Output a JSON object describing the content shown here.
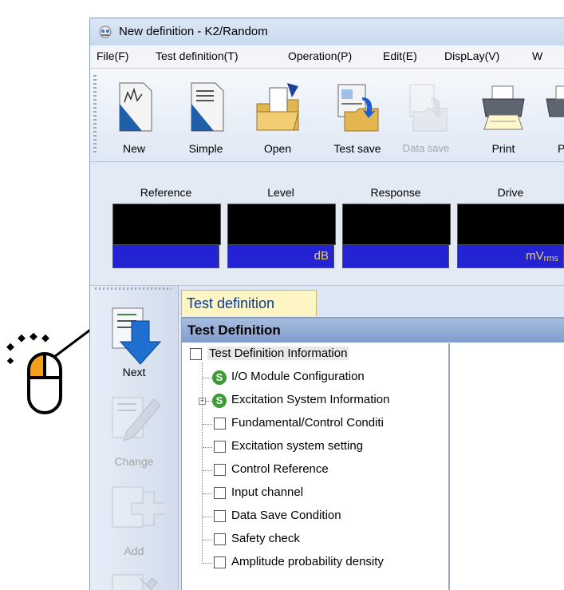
{
  "window": {
    "title": "New definition - K2/Random"
  },
  "menu": {
    "items": [
      "File(F)",
      "Test definition(T)",
      "Operation(P)",
      "Edit(E)",
      "DispLay(V)",
      "W"
    ]
  },
  "toolbar": {
    "buttons": [
      {
        "label": "New",
        "icon": "new-document-icon",
        "enabled": true
      },
      {
        "label": "Simple",
        "icon": "simple-document-icon",
        "enabled": true
      },
      {
        "label": "Open",
        "icon": "open-folder-icon",
        "enabled": true
      },
      {
        "label": "Test save",
        "icon": "test-save-icon",
        "enabled": true
      },
      {
        "label": "Data save",
        "icon": "data-save-icon",
        "enabled": false
      },
      {
        "label": "Print",
        "icon": "printer-icon",
        "enabled": true
      },
      {
        "label": "Pr",
        "icon": "print-preview-icon",
        "enabled": true
      }
    ]
  },
  "meters": [
    {
      "label": "Reference",
      "unit": ""
    },
    {
      "label": "Level",
      "unit": "dB"
    },
    {
      "label": "Response",
      "unit": ""
    },
    {
      "label": "Drive",
      "unit": "mV",
      "unit_sub": "rms"
    }
  ],
  "sidebar": {
    "buttons": [
      {
        "label": "Next",
        "icon": "next-arrow-icon",
        "enabled": true
      },
      {
        "label": "Change",
        "icon": "change-pencil-icon",
        "enabled": false
      },
      {
        "label": "Add",
        "icon": "add-plus-icon",
        "enabled": false
      }
    ]
  },
  "tabs": {
    "active": "Test definition"
  },
  "panel": {
    "header": "Test Definition",
    "tree": [
      {
        "label": "Test Definition Information",
        "marker": "checkbox",
        "level": 0
      },
      {
        "label": "I/O Module Configuration",
        "marker": "s-badge",
        "level": 1
      },
      {
        "label": "Excitation System Information",
        "marker": "s-badge",
        "level": 1,
        "expander": "+"
      },
      {
        "label": "Fundamental/Control Conditi",
        "marker": "checkbox",
        "level": 1
      },
      {
        "label": "Excitation system setting",
        "marker": "checkbox",
        "level": 1
      },
      {
        "label": "Control Reference",
        "marker": "checkbox",
        "level": 1
      },
      {
        "label": "Input channel",
        "marker": "checkbox",
        "level": 1
      },
      {
        "label": "Data Save Condition",
        "marker": "checkbox",
        "level": 1
      },
      {
        "label": "Safety check",
        "marker": "checkbox",
        "level": 1
      },
      {
        "label": "Amplitude probability density",
        "marker": "checkbox",
        "level": 1
      }
    ]
  },
  "colors": {
    "meter_screen": "#000000",
    "meter_unit_bg": "#2323d3",
    "meter_unit_text": "#f2d24a",
    "panel_header": "#8fa9d4",
    "tab_bg": "#fdf6c4",
    "s_badge": "#3c9b32",
    "arrow_blue": "#1e6fd0",
    "mouse_highlight": "#f5a01a"
  }
}
